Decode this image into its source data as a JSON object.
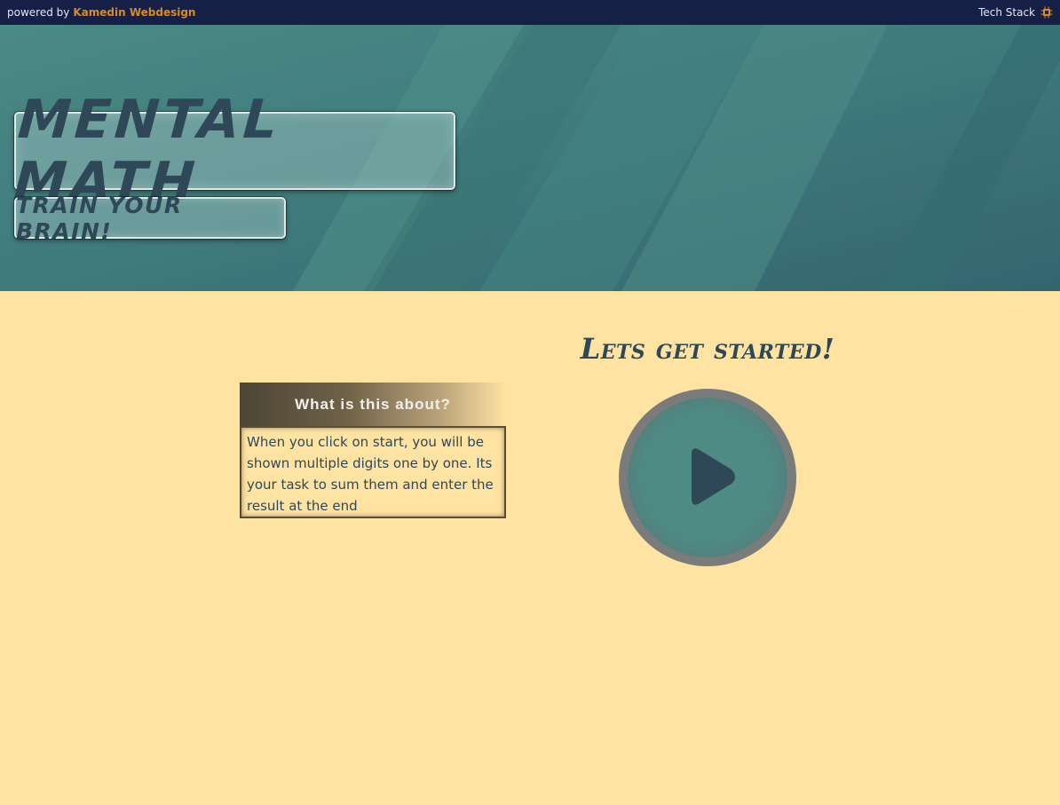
{
  "topbar": {
    "powered_by": "powered by",
    "brand": "Kamedin Webdesign",
    "tech_stack": "Tech Stack",
    "tech_stack_icon": "chip-icon"
  },
  "hero": {
    "title": "Mental Math",
    "subtitle": "Train your brain!"
  },
  "info": {
    "heading": "What is this about?",
    "body": "When you click on start, you will be shown multiple digits one by one. Its your task to sum them and enter the result at the end"
  },
  "start": {
    "heading": "Lets get started!",
    "play_icon": "play-icon"
  },
  "colors": {
    "topbar_bg": "#162047",
    "brand": "#d98b21",
    "hero_teal": "#3d7377",
    "page_bg": "#fee3a3",
    "text_dark": "#2f4858",
    "play_ring": "#7a7b7b",
    "play_fill": "#4e8b84"
  }
}
